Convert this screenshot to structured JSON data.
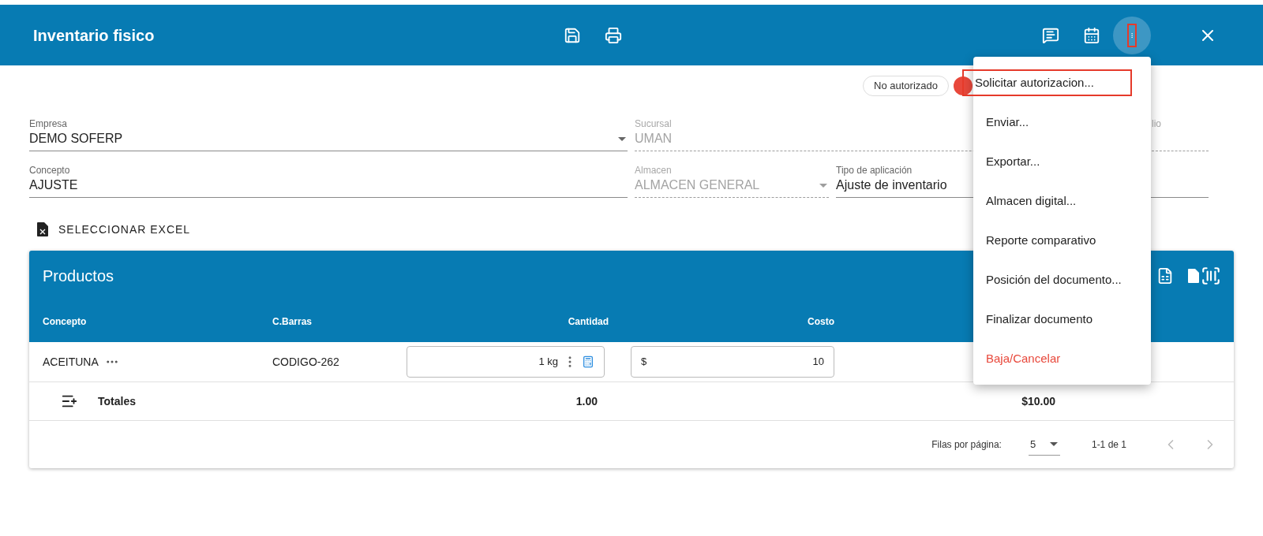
{
  "header": {
    "title": "Inventario fisico",
    "menu_open": true,
    "menu_button_annotated": true
  },
  "status": {
    "label": "No autorizado",
    "color": "#e8483b"
  },
  "form": {
    "rows": [
      [
        {
          "label": "Empresa",
          "value": "DEMO SOFERP",
          "kind": "select",
          "disabled": false
        },
        {
          "label": "Sucursal",
          "value": "UMAN",
          "kind": "text",
          "disabled": true
        },
        {
          "label": "lio",
          "kind": "text",
          "disabled": true
        }
      ],
      [
        {
          "label": "Concepto",
          "value": "AJUSTE",
          "kind": "text",
          "disabled": false
        },
        {
          "label": "Almacen",
          "value": "ALMACEN GENERAL",
          "kind": "select",
          "disabled": true
        },
        {
          "label": "Tipo de aplicación",
          "value": "Ajuste de inventario",
          "kind": "text",
          "disabled": false
        }
      ]
    ]
  },
  "excel_button": {
    "label": "SELECCIONAR EXCEL"
  },
  "table": {
    "title": "Productos",
    "columns": [
      {
        "label": "Concepto"
      },
      {
        "label": "C.Barras"
      },
      {
        "label": "Cantidad"
      },
      {
        "label": "Costo"
      }
    ],
    "rows": [
      {
        "concepto": "ACEITUNA",
        "barcode": "CODIGO-262",
        "quantity": "1 kg",
        "cost_prefix": "$",
        "cost": "10"
      }
    ],
    "totals": {
      "label": "Totales",
      "quantity": "1.00",
      "cost": "$10.00"
    },
    "pagination": {
      "rows_label": "Filas por página:",
      "rows_per_page": "5",
      "range": "1-1 de 1"
    }
  },
  "menu": {
    "items": [
      {
        "label": "Solicitar autorizacion...",
        "kind": "normal",
        "highlighted": true
      },
      {
        "label": "Enviar...",
        "kind": "normal",
        "highlighted": false
      },
      {
        "label": "Exportar...",
        "kind": "normal",
        "highlighted": false
      },
      {
        "label": "Almacen digital...",
        "kind": "normal",
        "highlighted": false
      },
      {
        "label": "Reporte comparativo",
        "kind": "normal",
        "highlighted": false
      },
      {
        "label": "Posición del documento...",
        "kind": "normal",
        "highlighted": false
      },
      {
        "label": "Finalizar documento",
        "kind": "normal",
        "highlighted": false
      },
      {
        "label": "Baja/Cancelar",
        "kind": "danger",
        "highlighted": false
      }
    ]
  }
}
